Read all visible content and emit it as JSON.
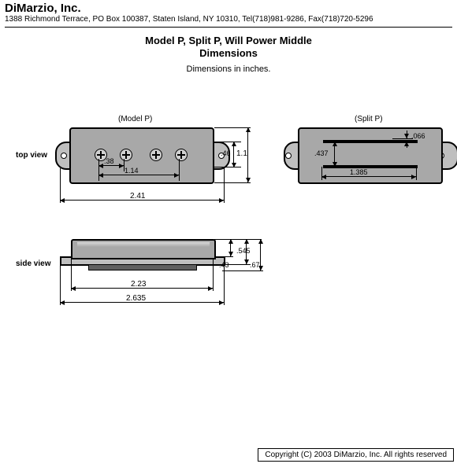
{
  "header": {
    "company": "DiMarzio, Inc.",
    "address": "1388 Richmond Terrace, PO Box 100387, Staten Island, NY 10310, Tel(718)981-9286, Fax(718)720-5296"
  },
  "title_line1": "Model P, Split P, Will Power Middle",
  "title_line2": "Dimensions",
  "subtitle": "Dimensions in inches.",
  "labels": {
    "model_p": "(Model P)",
    "split_p": "(Split P)",
    "top_view": "top view",
    "side_view": "side view"
  },
  "dims": {
    "top_view": {
      "screw_spacing_small": ".38",
      "screw_spacing_large": "1.14",
      "body_width": "2.41",
      "body_inner_height": ".46",
      "body_outer_height": "1.1"
    },
    "split_p": {
      "bar_length": "1.385",
      "bar_spacing": ".437",
      "bar_thickness": ".066"
    },
    "side_view": {
      "body_height": ".43",
      "cover_height": ".545",
      "total_height": ".67",
      "body_length": "2.23",
      "overall_length": "2.635"
    }
  },
  "footer": "Copyright (C) 2003 DiMarzio, Inc. All rights reserved"
}
